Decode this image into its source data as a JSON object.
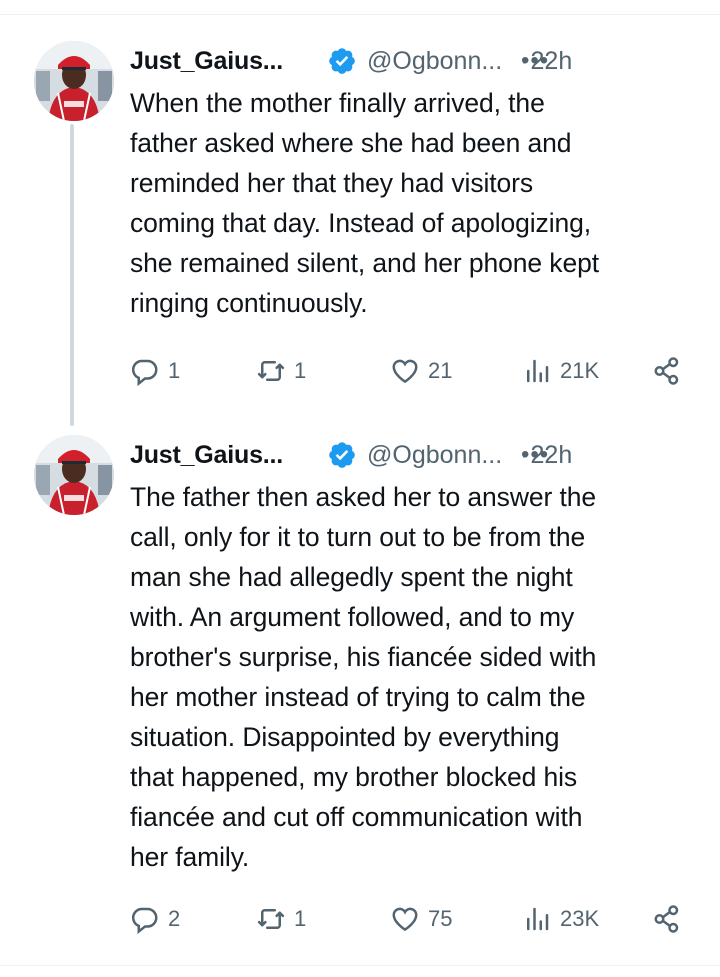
{
  "tweets": [
    {
      "name": "Just_Gaius...",
      "handle": "@Ogbonn...",
      "separator": "·",
      "time": "22h",
      "more": "•••",
      "text": "When the mother finally arrived, the\nfather asked where she had been and\nreminded her that they had visitors\ncoming that day. Instead of apologizing,\nshe remained silent, and her phone kept\nringing continuously.",
      "replies": "1",
      "reposts": "1",
      "likes": "21",
      "views": "21K"
    },
    {
      "name": "Just_Gaius...",
      "handle": "@Ogbonn...",
      "separator": "·",
      "time": "22h",
      "more": "•••",
      "text": "The father then asked her to answer the\ncall, only for it to turn out to be from the\nman she had allegedly spent the night\nwith. An argument followed, and to my\nbrother's surprise, his fiancée sided with\nher mother instead of trying to calm the\nsituation. Disappointed by everything\nthat happened, my brother blocked his\nfiancée and cut off communication with\nher family.",
      "replies": "2",
      "reposts": "1",
      "likes": "75",
      "views": "23K"
    }
  ],
  "icons": {
    "verified": "verified-badge-icon",
    "reply": "reply-icon",
    "repost": "repost-icon",
    "like": "heart-icon",
    "views": "views-icon",
    "share": "share-icon",
    "more": "more-icon"
  },
  "colors": {
    "text": "#0f1419",
    "secondary": "#536471",
    "verified": "#1d9bf0",
    "thread_line": "#cfd9de"
  }
}
